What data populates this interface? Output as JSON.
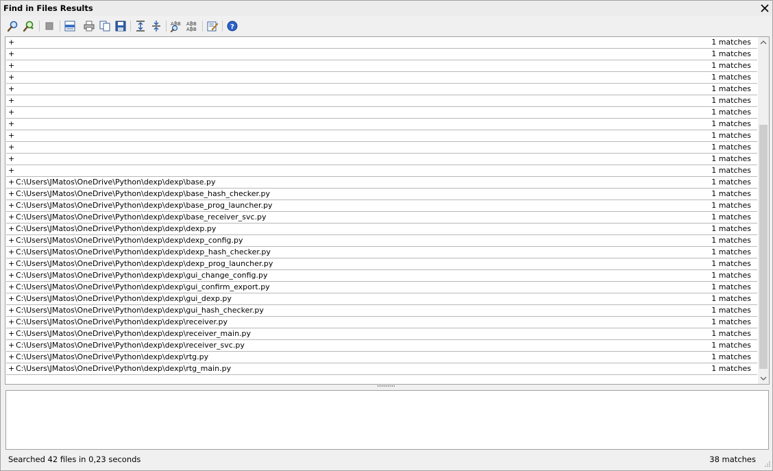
{
  "window": {
    "title": "Find in Files Results"
  },
  "toolbar": {
    "buttons": [
      {
        "name": "find-icon"
      },
      {
        "name": "replace-icon"
      },
      {
        "name": "stop-icon"
      },
      {
        "name": "print-preview-icon"
      },
      {
        "name": "print-icon"
      },
      {
        "name": "copy-icon"
      },
      {
        "name": "save-icon"
      },
      {
        "name": "expand-all-icon"
      },
      {
        "name": "collapse-all-icon"
      },
      {
        "name": "find-in-results-icon"
      },
      {
        "name": "replace-in-results-icon"
      },
      {
        "name": "open-in-editor-icon"
      },
      {
        "name": "help-icon"
      }
    ]
  },
  "results": {
    "rows": [
      {
        "expander": "+",
        "path": "",
        "count": "1 matches"
      },
      {
        "expander": "+",
        "path": "",
        "count": "1 matches"
      },
      {
        "expander": "+",
        "path": "",
        "count": "1 matches"
      },
      {
        "expander": "+",
        "path": "",
        "count": "1 matches"
      },
      {
        "expander": "+",
        "path": "",
        "count": "1 matches"
      },
      {
        "expander": "+",
        "path": "",
        "count": "1 matches"
      },
      {
        "expander": "+",
        "path": "",
        "count": "1 matches"
      },
      {
        "expander": "+",
        "path": "",
        "count": "1 matches"
      },
      {
        "expander": "+",
        "path": "",
        "count": "1 matches"
      },
      {
        "expander": "+",
        "path": "",
        "count": "1 matches"
      },
      {
        "expander": "+",
        "path": "",
        "count": "1 matches"
      },
      {
        "expander": "+",
        "path": "",
        "count": "1 matches"
      },
      {
        "expander": "+",
        "path": "C:\\Users\\JMatos\\OneDrive\\Python\\dexp\\dexp\\base.py",
        "count": "1 matches"
      },
      {
        "expander": "+",
        "path": "C:\\Users\\JMatos\\OneDrive\\Python\\dexp\\dexp\\base_hash_checker.py",
        "count": "1 matches"
      },
      {
        "expander": "+",
        "path": "C:\\Users\\JMatos\\OneDrive\\Python\\dexp\\dexp\\base_prog_launcher.py",
        "count": "1 matches"
      },
      {
        "expander": "+",
        "path": "C:\\Users\\JMatos\\OneDrive\\Python\\dexp\\dexp\\base_receiver_svc.py",
        "count": "1 matches"
      },
      {
        "expander": "+",
        "path": "C:\\Users\\JMatos\\OneDrive\\Python\\dexp\\dexp\\dexp.py",
        "count": "1 matches"
      },
      {
        "expander": "+",
        "path": "C:\\Users\\JMatos\\OneDrive\\Python\\dexp\\dexp\\dexp_config.py",
        "count": "1 matches"
      },
      {
        "expander": "+",
        "path": "C:\\Users\\JMatos\\OneDrive\\Python\\dexp\\dexp\\dexp_hash_checker.py",
        "count": "1 matches"
      },
      {
        "expander": "+",
        "path": "C:\\Users\\JMatos\\OneDrive\\Python\\dexp\\dexp\\dexp_prog_launcher.py",
        "count": "1 matches"
      },
      {
        "expander": "+",
        "path": "C:\\Users\\JMatos\\OneDrive\\Python\\dexp\\dexp\\gui_change_config.py",
        "count": "1 matches"
      },
      {
        "expander": "+",
        "path": "C:\\Users\\JMatos\\OneDrive\\Python\\dexp\\dexp\\gui_confirm_export.py",
        "count": "1 matches"
      },
      {
        "expander": "+",
        "path": "C:\\Users\\JMatos\\OneDrive\\Python\\dexp\\dexp\\gui_dexp.py",
        "count": "1 matches"
      },
      {
        "expander": "+",
        "path": "C:\\Users\\JMatos\\OneDrive\\Python\\dexp\\dexp\\gui_hash_checker.py",
        "count": "1 matches"
      },
      {
        "expander": "+",
        "path": "C:\\Users\\JMatos\\OneDrive\\Python\\dexp\\dexp\\receiver.py",
        "count": "1 matches"
      },
      {
        "expander": "+",
        "path": "C:\\Users\\JMatos\\OneDrive\\Python\\dexp\\dexp\\receiver_main.py",
        "count": "1 matches"
      },
      {
        "expander": "+",
        "path": "C:\\Users\\JMatos\\OneDrive\\Python\\dexp\\dexp\\receiver_svc.py",
        "count": "1 matches"
      },
      {
        "expander": "+",
        "path": "C:\\Users\\JMatos\\OneDrive\\Python\\dexp\\dexp\\rtg.py",
        "count": "1 matches"
      },
      {
        "expander": "+",
        "path": "C:\\Users\\JMatos\\OneDrive\\Python\\dexp\\dexp\\rtg_main.py",
        "count": "1 matches"
      }
    ]
  },
  "status": {
    "summary": "Searched 42 files in 0,23 seconds",
    "total_matches": "38 matches"
  },
  "colors": {
    "row_border": "#b8b8b8",
    "panel_border": "#a0a0a0",
    "thumb": "#cdcdcd"
  }
}
